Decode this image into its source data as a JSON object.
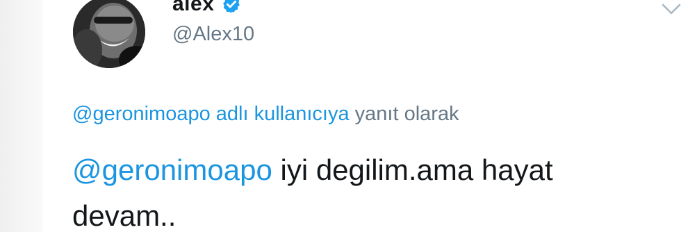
{
  "author": {
    "display_name": "alex",
    "handle": "@Alex10",
    "verified": true
  },
  "reply_context": {
    "mention": "@geronimoapo adlı kullanıcıya",
    "suffix": "yanıt olarak"
  },
  "tweet": {
    "mention": "@geronimoapo",
    "text": " iyi degilim.ama hayat devam.."
  },
  "icons": {
    "verified": "verified-badge-icon",
    "menu": "chevron-down-icon"
  },
  "colors": {
    "link": "#1b95e0",
    "secondary_text": "#657786",
    "primary_text": "#14171a",
    "verified": "#1da1f2"
  }
}
